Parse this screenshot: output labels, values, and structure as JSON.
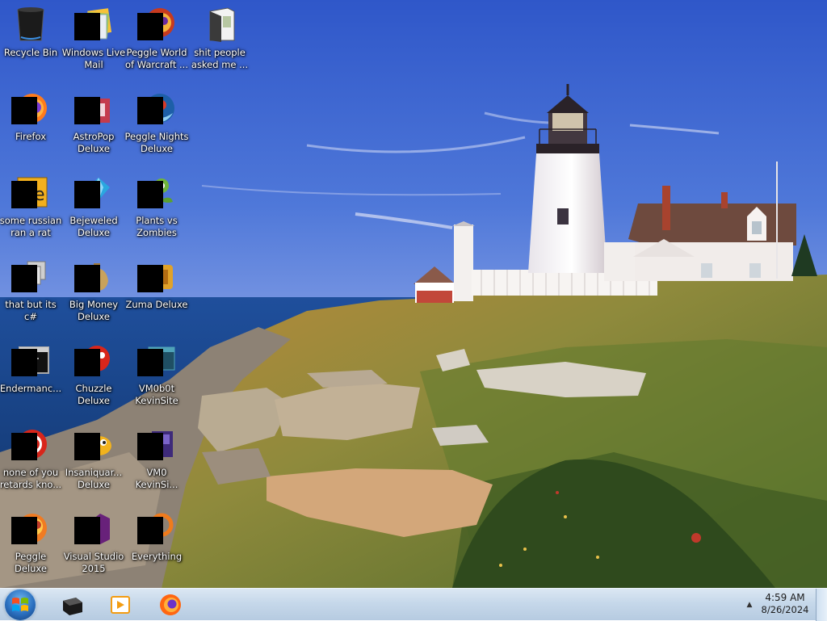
{
  "desktop": {
    "icons": [
      {
        "label": "Recycle Bin",
        "icon": "recycle-bin-icon"
      },
      {
        "label": "Windows Live Mail",
        "icon": "windows-live-mail-icon"
      },
      {
        "label": "Peggle World of Warcraft ...",
        "icon": "peggle-wow-icon"
      },
      {
        "label": "shit people asked me ...",
        "icon": "folder-icon"
      },
      {
        "label": "Firefox",
        "icon": "firefox-icon"
      },
      {
        "label": "AstroPop Deluxe",
        "icon": "astropop-icon"
      },
      {
        "label": "Peggle Nights Deluxe",
        "icon": "peggle-nights-icon"
      },
      {
        "label": "some russian ran a rat",
        "icon": "document-icon"
      },
      {
        "label": "Bejeweled Deluxe",
        "icon": "bejeweled-icon"
      },
      {
        "label": "Plants vs Zombies",
        "icon": "plants-vs-zombies-icon"
      },
      {
        "label": "that but its c#",
        "icon": "stacked-windows-icon"
      },
      {
        "label": "Big Money Deluxe",
        "icon": "big-money-icon"
      },
      {
        "label": "Zuma Deluxe",
        "icon": "zuma-icon"
      },
      {
        "label": "Endermanc...",
        "icon": "console-window-icon"
      },
      {
        "label": "Chuzzle Deluxe",
        "icon": "chuzzle-icon"
      },
      {
        "label": "VM0b0t KevinSite",
        "icon": "vm-terminal-icon"
      },
      {
        "label": "none of you retards kno...",
        "icon": "red-circle-icon"
      },
      {
        "label": "Insaniquar... Deluxe",
        "icon": "insaniquarium-icon"
      },
      {
        "label": "VM0 KevinSi...",
        "icon": "vm-icon"
      },
      {
        "label": "Peggle Deluxe",
        "icon": "peggle-icon"
      },
      {
        "label": "Visual Studio 2015",
        "icon": "visual-studio-icon"
      },
      {
        "label": "Everything",
        "icon": "everything-search-icon"
      }
    ]
  },
  "taskbar": {
    "start": {
      "icon": "windows-logo-icon"
    },
    "pinned": [
      {
        "name": "terminal",
        "icon": "terminal-icon"
      },
      {
        "name": "media-player",
        "icon": "media-player-icon"
      },
      {
        "name": "firefox",
        "icon": "firefox-icon"
      }
    ],
    "tray": {
      "chevron": "▲",
      "time": "4:59 AM",
      "date": "8/26/2024"
    }
  }
}
